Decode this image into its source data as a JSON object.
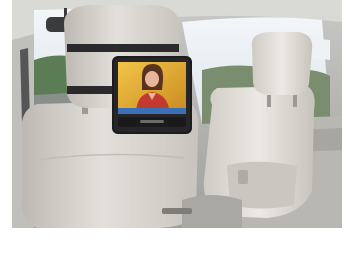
{
  "photo": {
    "subject": "car-interior-headrest-dvd-player",
    "screen_content": "news-anchor",
    "logo_text": ""
  },
  "colors": {
    "seat": "#d9d6d0",
    "window_sky": "#e8edf2",
    "trees": "#5b7c54",
    "player_body": "#1c1c1e",
    "screen_bg": "#d8a32a"
  }
}
